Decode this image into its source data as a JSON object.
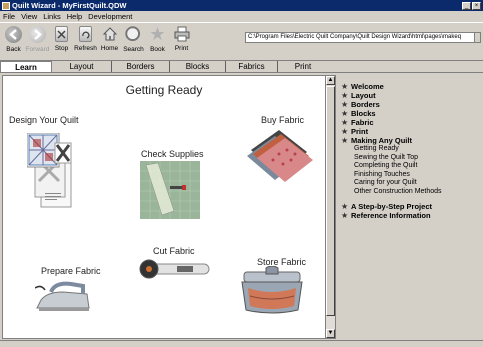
{
  "window": {
    "title": "Quilt Wizard - MyFirstQuilt.QDW",
    "minimize_glyph": "_",
    "close_glyph": "×"
  },
  "menu": [
    "File",
    "View",
    "Links",
    "Help",
    "Development"
  ],
  "toolbar": {
    "back": "Back",
    "forward": "Forward",
    "stop": "Stop",
    "refresh": "Refresh",
    "home": "Home",
    "search": "Search",
    "book": "Book",
    "print": "Print",
    "address": "C:\\Program Files\\Electric Quilt Company\\Quilt Design Wizard\\html\\pages\\makeq"
  },
  "tabs": [
    "Learn",
    "Layout",
    "Borders",
    "Blocks",
    "Fabrics",
    "Print"
  ],
  "main": {
    "heading": "Getting Ready",
    "sections": {
      "design": "Design Your Quilt",
      "check": "Check Supplies",
      "buy": "Buy Fabric",
      "cut": "Cut Fabric",
      "prepare": "Prepare Fabric",
      "store": "Store Fabric"
    }
  },
  "nav": {
    "top": [
      "Welcome",
      "Layout",
      "Borders",
      "Blocks",
      "Fabric",
      "Print",
      "Making Any Quilt"
    ],
    "sub": [
      "Getting Ready",
      "Sewing the Quilt Top",
      "Completing the Quilt",
      "Finishing Touches",
      "Caring for your Quilt",
      "Other Construction Methods"
    ],
    "bottom": [
      "A Step-by-Step Project",
      "Reference Information"
    ]
  },
  "colors": {
    "titlebar": "#0b2a6b",
    "chrome": "#d4d0c8"
  }
}
